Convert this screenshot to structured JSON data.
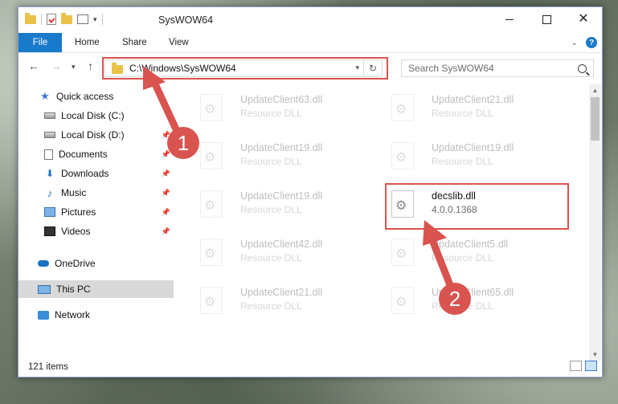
{
  "window": {
    "title": "SysWOW64"
  },
  "ribbon": {
    "tabs": [
      {
        "label": "File"
      },
      {
        "label": "Home"
      },
      {
        "label": "Share"
      },
      {
        "label": "View"
      }
    ]
  },
  "address": {
    "path": "C:\\Windows\\SysWOW64",
    "search_placeholder": "Search SysWOW64"
  },
  "sidebar": {
    "items": [
      {
        "label": "Quick access",
        "icon": "star-icon"
      },
      {
        "label": "Local Disk (C:)",
        "icon": "disk-icon"
      },
      {
        "label": "Local Disk (D:)",
        "icon": "disk-icon"
      },
      {
        "label": "Documents",
        "icon": "documents-icon"
      },
      {
        "label": "Downloads",
        "icon": "download-icon"
      },
      {
        "label": "Music",
        "icon": "music-icon"
      },
      {
        "label": "Pictures",
        "icon": "pictures-icon"
      },
      {
        "label": "Videos",
        "icon": "videos-icon"
      },
      {
        "label": "OneDrive",
        "icon": "cloud-icon"
      },
      {
        "label": "This PC",
        "icon": "computer-icon"
      },
      {
        "label": "Network",
        "icon": "network-icon"
      }
    ]
  },
  "files": [
    {
      "name": "UpdateClient63.dll",
      "desc": "Resource DLL"
    },
    {
      "name": "UpdateClient21.dll",
      "desc": "Resource DLL"
    },
    {
      "name": "UpdateClient19.dll",
      "desc": "Resource DLL"
    },
    {
      "name": "UpdateClient19.dll",
      "desc": "Resource DLL"
    },
    {
      "name": "UpdateClient19.dll",
      "desc": "Resource DLL"
    },
    {
      "name": "decslib.dll",
      "desc": "4.0.0.1368"
    },
    {
      "name": "UpdateClient42.dll",
      "desc": "Resource DLL"
    },
    {
      "name": "UpdateClient5.dll",
      "desc": "Resource DLL"
    },
    {
      "name": "UpdateClient21.dll",
      "desc": "Resource DLL"
    },
    {
      "name": "UpdateClient65.dll",
      "desc": "Resource DLL"
    }
  ],
  "status": {
    "item_count": "121 items"
  },
  "annotations": {
    "step1": "1",
    "step2": "2",
    "color": "#d9534f"
  }
}
